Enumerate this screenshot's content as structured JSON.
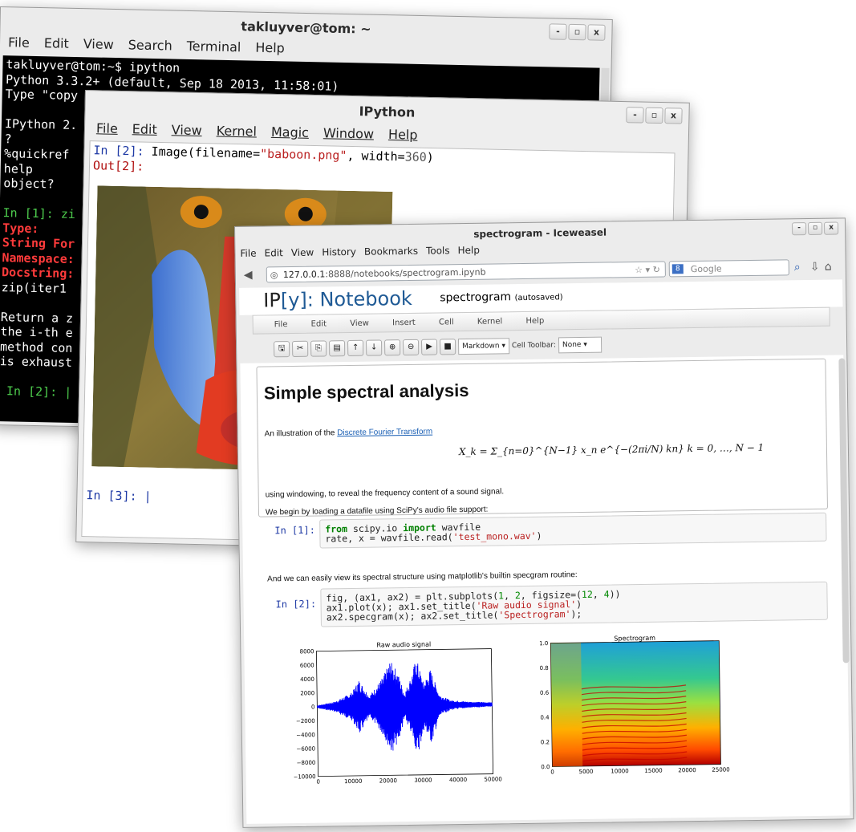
{
  "terminal": {
    "title": "takluyver@tom: ~",
    "menu": [
      "File",
      "Edit",
      "View",
      "Search",
      "Terminal",
      "Help"
    ],
    "window_buttons": [
      "-",
      "▫",
      "x"
    ],
    "lines": [
      {
        "text": "takluyver@tom:~$ ipython",
        "style": "normal"
      },
      {
        "text": "Python 3.3.2+ (default, Sep 18 2013, 11:58:01)",
        "style": "normal"
      },
      {
        "text": "Type \"copy",
        "style": "normal"
      },
      {
        "text": "",
        "style": "normal"
      },
      {
        "text": "IPython 2.",
        "style": "normal"
      },
      {
        "text": "?",
        "style": "normal"
      },
      {
        "text": "%quickref",
        "style": "normal"
      },
      {
        "text": "help",
        "style": "normal"
      },
      {
        "text": "object?",
        "style": "normal"
      },
      {
        "text": "",
        "style": "normal"
      },
      {
        "text": "In [1]: zi",
        "style": "green"
      },
      {
        "text": "Type:",
        "style": "red"
      },
      {
        "text": "String For",
        "style": "red"
      },
      {
        "text": "Namespace:",
        "style": "red"
      },
      {
        "text": "Docstring:",
        "style": "red"
      },
      {
        "text": "zip(iter1",
        "style": "normal"
      },
      {
        "text": "",
        "style": "normal"
      },
      {
        "text": "Return a z",
        "style": "normal"
      },
      {
        "text": "the i-th e",
        "style": "normal"
      },
      {
        "text": "method con",
        "style": "normal"
      },
      {
        "text": "is exhaust",
        "style": "normal"
      },
      {
        "text": "",
        "style": "normal"
      },
      {
        "text": " In [2]: |",
        "style": "green"
      }
    ]
  },
  "qtconsole": {
    "title": "IPython",
    "menu": [
      "File",
      "Edit",
      "View",
      "Kernel",
      "Magic",
      "Window",
      "Help"
    ],
    "window_buttons": [
      "-",
      "▫",
      "x"
    ],
    "in2_prompt": "In [2]:",
    "in2_code_a": " Image(filename=",
    "in2_code_str": "\"baboon.png\"",
    "in2_code_b": ", width=",
    "in2_code_num": "360",
    "in2_code_c": ")",
    "out2_prompt": "Out[2]:",
    "in3_prompt": "In [3]: |"
  },
  "browser": {
    "title": "spectrogram - Iceweasel",
    "menu": [
      "File",
      "Edit",
      "View",
      "History",
      "Bookmarks",
      "Tools",
      "Help"
    ],
    "window_buttons": [
      "-",
      "▫",
      "x"
    ],
    "url_host": "127.0.0.1",
    "url_rest": ":8888/notebooks/spectrogram.ipynb",
    "search_placeholder": "Google",
    "notebook": {
      "logo_ip": "IP",
      "logo_rest": "[y]: Notebook",
      "name": "spectrogram",
      "status": "(autosaved)",
      "menu": [
        "File",
        "Edit",
        "View",
        "Insert",
        "Cell",
        "Kernel",
        "Help"
      ],
      "cell_type": "Markdown",
      "cell_toolbar_label": "Cell Toolbar:",
      "cell_toolbar_value": "None",
      "heading": "Simple spectral analysis",
      "intro_prefix": "An illustration of the ",
      "intro_link": "Discrete Fourier Transform",
      "formula": "X_k = Σ_{n=0}^{N−1} x_n e^{−(2πi/N) kn}      k = 0, …, N − 1",
      "para2": "using windowing, to reveal the frequency content of a sound signal.",
      "para3": "We begin by loading a datafile using SciPy's audio file support:",
      "cell1_prompt": "In [1]:",
      "cell1_line1_kw1": "from",
      "cell1_line1_a": " scipy.io ",
      "cell1_line1_kw2": "import",
      "cell1_line1_b": " wavfile",
      "cell1_line2_a": "rate, x = wavfile.read(",
      "cell1_line2_str": "'test_mono.wav'",
      "cell1_line2_b": ")",
      "para4": "And we can easily view its spectral structure using matplotlib's builtin specgram routine:",
      "cell2_prompt": "In [2]:",
      "cell2_line1_a": "fig, (ax1, ax2) = plt.subplots(",
      "cell2_line1_n1": "1",
      "cell2_line1_b": ", ",
      "cell2_line1_n2": "2",
      "cell2_line1_c": ", figsize=(",
      "cell2_line1_n3": "12",
      "cell2_line1_d": ", ",
      "cell2_line1_n4": "4",
      "cell2_line1_e": "))",
      "cell2_line2_a": "ax1.plot(x); ax1.set_title(",
      "cell2_line2_str": "'Raw audio signal'",
      "cell2_line2_b": ")",
      "cell2_line3_a": "ax2.specgram(x); ax2.set_title(",
      "cell2_line3_str": "'Spectrogram'",
      "cell2_line3_b": ");"
    }
  },
  "chart_data": [
    {
      "type": "line",
      "title": "Raw audio signal",
      "xlabel": "",
      "ylabel": "",
      "xlim": [
        0,
        50000
      ],
      "ylim": [
        -10000,
        8000
      ],
      "x_ticks": [
        "0",
        "10000",
        "20000",
        "30000",
        "40000",
        "50000"
      ],
      "y_ticks": [
        "8000",
        "6000",
        "4000",
        "2000",
        "0",
        "−2000",
        "−4000",
        "−6000",
        "−8000",
        "−10000"
      ],
      "color": "#0000ff",
      "envelope": [
        {
          "x": 0,
          "y": 200
        },
        {
          "x": 5000,
          "y": 700
        },
        {
          "x": 10000,
          "y": 2000
        },
        {
          "x": 12000,
          "y": 3800
        },
        {
          "x": 15000,
          "y": 1500
        },
        {
          "x": 19000,
          "y": 4200
        },
        {
          "x": 21000,
          "y": 6500
        },
        {
          "x": 23000,
          "y": 5000
        },
        {
          "x": 25000,
          "y": 1800
        },
        {
          "x": 27000,
          "y": 4200
        },
        {
          "x": 28500,
          "y": 6900
        },
        {
          "x": 30500,
          "y": 3200
        },
        {
          "x": 32500,
          "y": 5200
        },
        {
          "x": 35000,
          "y": 1500
        },
        {
          "x": 38000,
          "y": 700
        },
        {
          "x": 43000,
          "y": 450
        },
        {
          "x": 50000,
          "y": 300
        }
      ]
    },
    {
      "type": "heatmap",
      "title": "Spectrogram",
      "xlim": [
        0,
        25000
      ],
      "ylim": [
        0.0,
        1.0
      ],
      "x_ticks": [
        "0",
        "5000",
        "10000",
        "15000",
        "20000",
        "25000"
      ],
      "y_ticks": [
        "1.0",
        "0.8",
        "0.6",
        "0.4",
        "0.2",
        "0.0"
      ],
      "colormap": "jet"
    }
  ]
}
